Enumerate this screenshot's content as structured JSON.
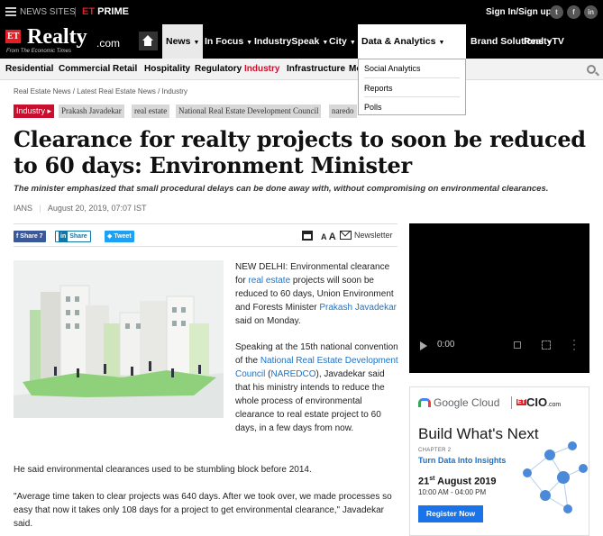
{
  "topbar": {
    "news_sites": "NEWS SITES",
    "et_prime_et": "ET",
    "et_prime_label": " PRIME",
    "sign_in": "Sign In/Sign up",
    "social": [
      "t",
      "f",
      "in"
    ]
  },
  "logo": {
    "et": "ET",
    "realty": "Realty",
    "dotcom": ".com",
    "from": "From The Economic Times"
  },
  "mainnav": {
    "items": [
      {
        "label": "News"
      },
      {
        "label": "In Focus"
      },
      {
        "label": "IndustrySpeak"
      },
      {
        "label": "City"
      },
      {
        "label": "Data & Analytics"
      },
      {
        "label": "Brand Solutions"
      },
      {
        "label": "RealtyTV"
      }
    ]
  },
  "categories": [
    "Residential",
    "Commercial",
    "Retail",
    "Hospitality",
    "Regulatory",
    "Industry",
    "Infrastructure",
    "Mo"
  ],
  "dropdown": {
    "items": [
      "Social Analytics",
      "Reports",
      "Polls"
    ]
  },
  "breadcrumb": "Real Estate News  /  Latest Real Estate News  /  Industry",
  "tags": [
    "Industry",
    "Prakash Javadekar",
    "real estate",
    "National Real Estate Development Council",
    "naredo"
  ],
  "article": {
    "title": "Clearance for realty projects to soon be reduced to 60 days: Environment Minister",
    "synopsis": "The minister emphasized that small procedural delays can be done away with, without compromising on environmental clearances.",
    "author": "IANS",
    "date": "August 20, 2019, 07:07 IST",
    "share": {
      "facebook": "Share 7",
      "linkedin_in": "in",
      "linkedin": "Share",
      "twitter": "Tweet",
      "font_small": "A",
      "font_large": "A",
      "newsletter": "Newsletter"
    },
    "p1": {
      "a": "NEW DELHI: Environmental clearance for ",
      "link1": "real estate",
      "b": " projects will soon be reduced to 60 days, Union Environment and Forests Minister ",
      "link2": "Prakash Javadekar",
      "c": " said on Monday."
    },
    "p2": {
      "a": "Speaking at the 15th national convention of the ",
      "link1": "National Real Estate Development Council",
      "b": " (",
      "link2": "NAREDCO",
      "c": "), Javadekar said that his ministry intends to reduce the whole process of environmental clearance to real estate project to 60 days, in a few days from now."
    },
    "p3": "He said environmental clearances used to be stumbling block before 2014.",
    "p4": "\"Average time taken to clear projects was 640 days. After we took over, we made processes so easy that now it takes only 108 days for a project to get environmental clearance,\" Javadekar said."
  },
  "video": {
    "time": "0:00"
  },
  "ad": {
    "google_cloud": "Google Cloud",
    "et": "ET",
    "cio": "CIO",
    "cio_suffix": ".com",
    "headline": "Build What's Next",
    "chapter": "CHAPTER 2",
    "subhead": "Turn Data Into Insights",
    "date_day": "21",
    "date_sup": "st",
    "date_rest": " August 2019",
    "time": "10:00 AM - 04:00 PM",
    "cta": "Register Now"
  },
  "colors": {
    "brand_red": "#e31e24",
    "link_blue": "#1a73c9",
    "industry_red": "#c8102e"
  }
}
